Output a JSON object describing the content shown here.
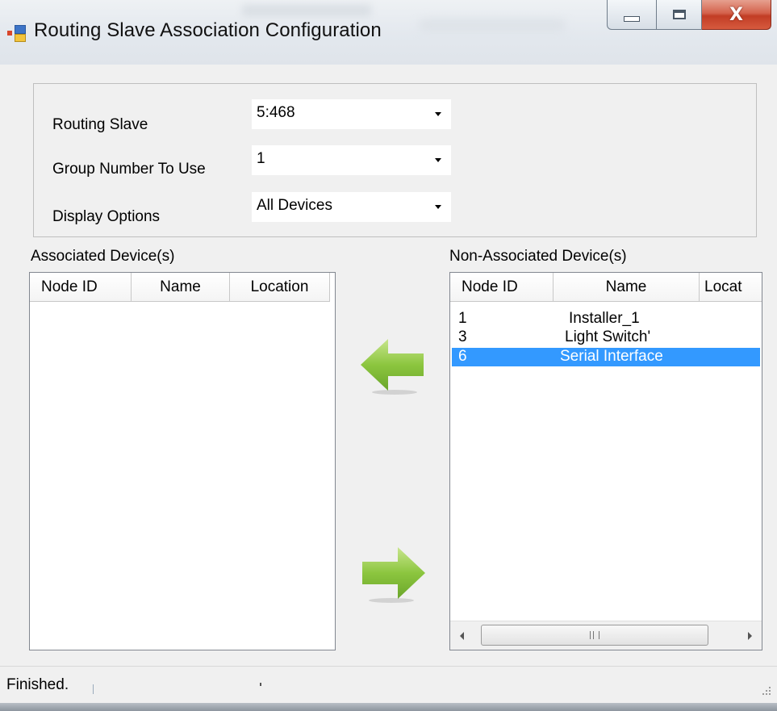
{
  "window": {
    "title": "Routing Slave Association Configuration",
    "buttons": {
      "minimize": "minimize",
      "maximize": "maximize",
      "close": "X"
    }
  },
  "options": {
    "routing_slave": {
      "label": "Routing Slave",
      "value": "5:468"
    },
    "group_number": {
      "label": "Group Number To Use",
      "value": "1"
    },
    "display_options": {
      "label": "Display Options",
      "value": "All Devices"
    }
  },
  "associated": {
    "label": "Associated Device(s)",
    "columns": [
      "Node ID",
      "Name",
      "Location"
    ],
    "rows": []
  },
  "non_associated": {
    "label": "Non-Associated Device(s)",
    "columns": [
      "Node ID",
      "Name",
      "Locat"
    ],
    "rows": [
      {
        "node_id": "1",
        "name": "Installer_1"
      },
      {
        "node_id": "3",
        "name": "Light Switch'"
      },
      {
        "node_id": "6",
        "name": "Serial Interface",
        "selected": true
      }
    ],
    "scroll_grip": "III"
  },
  "colors": {
    "selection": "#3399ff",
    "arrow_green": "#8cc63f"
  },
  "icons": {
    "move_left": "left-arrow-icon",
    "move_right": "right-arrow-icon"
  },
  "status": {
    "text": "Finished."
  }
}
